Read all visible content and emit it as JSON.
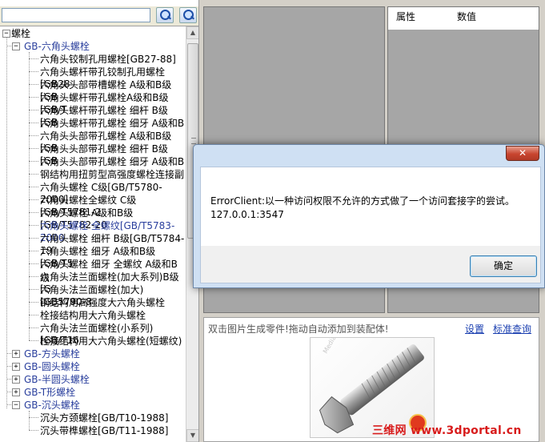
{
  "search": {
    "value": "",
    "search_button_1": "search-icon",
    "search_button_2": "search-icon"
  },
  "tree": {
    "root": "螺栓",
    "groups": [
      {
        "label": "GB-六角头螺栓",
        "expanded": true,
        "items": [
          "六角头铰制孔用螺栓[GB27-88]",
          "六角头螺杆带孔铰制孔用螺栓[GB28",
          "六角头头部带槽螺栓 A级和B级[GB",
          "六角头螺杆带孔螺栓A级和B级[GB/T",
          "六角头螺杆带孔螺栓 细杆 B级[GB",
          "六角头螺杆带孔螺栓 细牙 A级和B",
          "六角头头部带孔螺栓 A级和B级[GB",
          "六角头头部带孔螺栓 细杆 B级[GB",
          "六角头头部带孔螺栓 细牙 A级和B",
          "钢结构用扭剪型高强度螺栓连接副",
          "六角头螺栓 C级[GB/T5780-2000]",
          "六角头螺栓全螺纹 C级[GB/T5781-2",
          "六角头螺栓 A级和B级[GB/T5782-20",
          "六角头螺栓 全螺纹[GB/T5783-2000",
          "六角头螺栓 细杆 B级[GB/T5784-19",
          "六角头螺栓 细牙 A级和B级[GB/T5",
          "六角头螺栓 细牙 全螺纹 A级和B级",
          "六角头法兰面螺栓(加大系列)B级[G",
          "六角头法兰面螺栓(加大)[GB5790-8",
          "钢结构用高强度大六角头螺栓",
          "栓接结构用大六角头螺栓",
          "六角头法兰面螺栓(小系列)[GB/T16",
          "栓接结构用大六角头螺栓(短螺纹)"
        ]
      },
      {
        "label": "GB-方头螺栓",
        "expanded": false,
        "items": []
      },
      {
        "label": "GB-圆头螺栓",
        "expanded": false,
        "items": []
      },
      {
        "label": "GB-半圆头螺栓",
        "expanded": false,
        "items": []
      },
      {
        "label": "GB-T形螺栓",
        "expanded": false,
        "items": []
      },
      {
        "label": "GB-沉头螺栓",
        "expanded": true,
        "items": [
          "沉头方颈螺栓[GB/T10-1988]",
          "沉头带榫螺栓[GB/T11-1988]"
        ]
      }
    ],
    "selected_index": 13
  },
  "properties": {
    "col_attr": "属性",
    "col_value": "数值"
  },
  "bottom": {
    "hint": "双击图片生成零件!拖动自动添加到装配体!",
    "link_settings": "设置",
    "link_standard": "标准查询",
    "thumbnail_watermark": "MediaSoft"
  },
  "dialog": {
    "close_glyph": "✕",
    "message_line1": "ErrorClient:以一种访问权限不允许的方式做了一个访问套接字的尝试。",
    "message_line2": "127.0.0.1:3547",
    "ok_label": "确定"
  },
  "watermark": "三维网 www.3dportal.cn",
  "colors": {
    "tree_group": "#2a3f9d",
    "link": "#1a3fb0",
    "dialog_frame": "#cfe0f3",
    "watermark": "#d81c1c"
  }
}
